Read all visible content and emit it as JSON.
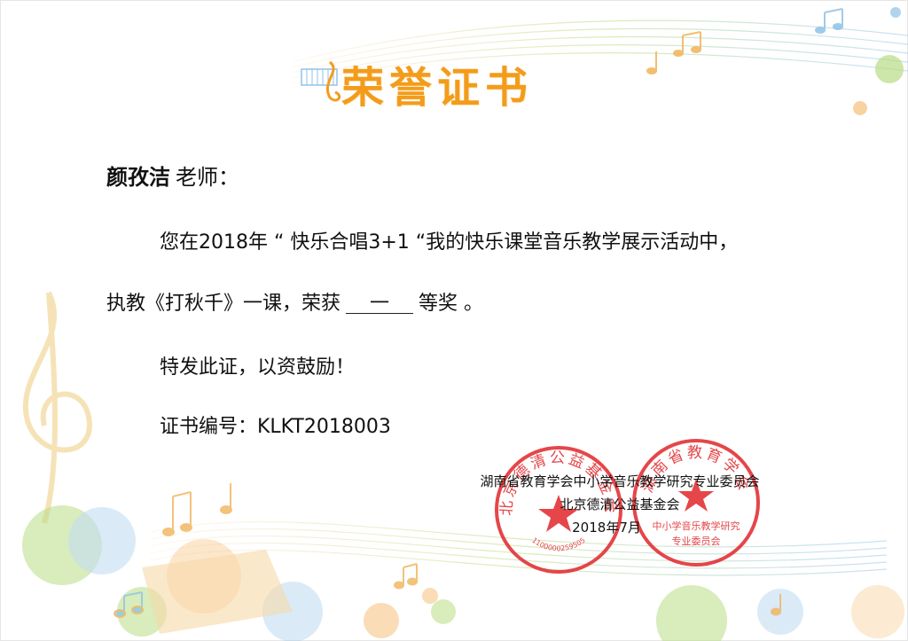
{
  "certificate": {
    "title": "荣誉证书",
    "recipient_name": "颜孜洁",
    "recipient_title": "老师：",
    "body_line1": "您在2018年 “ 快乐合唱3+1 “我的快乐课堂音乐教学展示活动中，",
    "body_line2_prefix": "执教《打秋千》一课，荣获",
    "award_level": "一",
    "body_line2_suffix": "等奖 。",
    "encouragement": "特发此证，以资鼓励！",
    "certificate_number": "证书编号：KLKT2018003",
    "issuer1": "湖南省教育学会中小学音乐教学研究专业委员会",
    "issuer2": "北京德清公益基金会",
    "date": "2018年7月"
  },
  "seals": {
    "seal1_text": "北京德清公益基金会",
    "seal1_number": "1100000259505",
    "seal2_text": "湖南省教育学会",
    "seal2_inner": "中小学音乐教学研究",
    "seal2_bottom": "专业委员会",
    "seal_color": "#e0262a"
  },
  "colors": {
    "title": "#f39c1c",
    "accent_green": "#a9d36b",
    "accent_orange": "#f6c07a",
    "accent_blue": "#8fc3e8"
  },
  "icons": [
    "music-note-icon",
    "treble-clef-icon",
    "piano-keys-icon"
  ]
}
